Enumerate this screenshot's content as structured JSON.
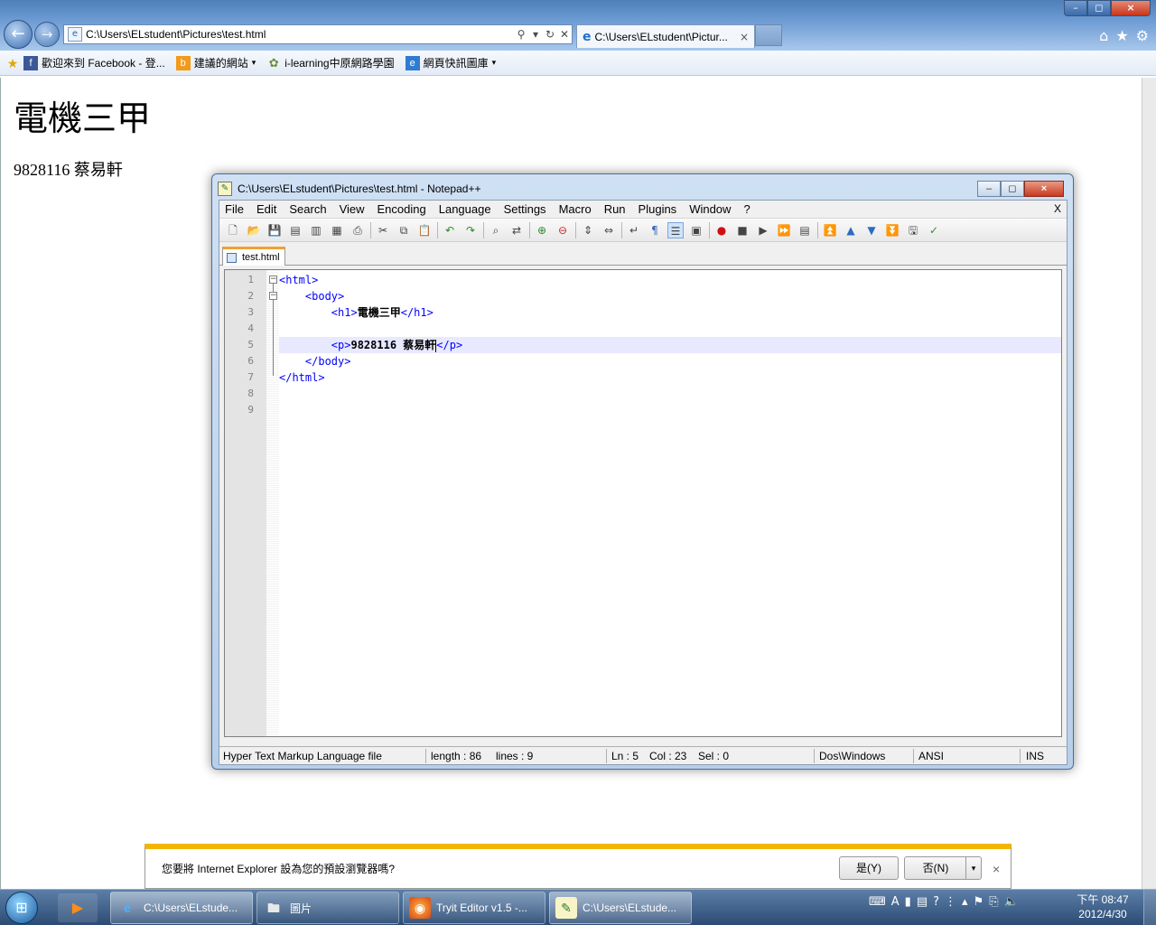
{
  "ie": {
    "address": "C:\\Users\\ELstudent\\Pictures\\test.html",
    "tab_title": "C:\\Users\\ELstudent\\Pictur...",
    "tab_close": "×",
    "win_min": "–",
    "win_max": "◻",
    "win_close": "×",
    "right_icons": {
      "home": "⌂",
      "favorites": "★",
      "tools": "⚙"
    },
    "nav": {
      "back": "←",
      "forward": "→"
    },
    "addr_tools": {
      "search": "⚲",
      "dropdown": "▾",
      "refresh": "↻",
      "stop": "✕"
    }
  },
  "favorites": {
    "items": [
      {
        "label": "歡迎來到 Facebook - 登...",
        "icon": "facebook-icon",
        "color": "#3b5998",
        "glyph": "f",
        "arrow": ""
      },
      {
        "label": "建議的網站",
        "icon": "suggested-sites-icon",
        "color": "#f29a1a",
        "glyph": "b",
        "arrow": "▾"
      },
      {
        "label": "i-learning中原網路學園",
        "icon": "ilearning-icon",
        "color": "#6a8f3c",
        "glyph": "✿",
        "arrow": ""
      },
      {
        "label": "網頁快訊圖庫",
        "icon": "web-slice-icon",
        "color": "#2f7bd1",
        "glyph": "e",
        "arrow": "▾"
      }
    ]
  },
  "page": {
    "h1": "電機三甲",
    "p": "9828116 蔡易軒"
  },
  "notification": {
    "text": "您要將 Internet Explorer 設為您的預設瀏覽器嗎?",
    "yes": "是(Y)",
    "no": "否(N)",
    "dropdown": "▾",
    "close": "×"
  },
  "npp": {
    "title": "C:\\Users\\ELstudent\\Pictures\\test.html - Notepad++",
    "menu": [
      "File",
      "Edit",
      "Search",
      "View",
      "Encoding",
      "Language",
      "Settings",
      "Macro",
      "Run",
      "Plugins",
      "Window",
      "?"
    ],
    "menu_close": "X",
    "tab": "test.html",
    "line_numbers": [
      "1",
      "2",
      "3",
      "4",
      "5",
      "6",
      "7",
      "8",
      "9"
    ],
    "code": {
      "l1": "<html>",
      "l2": "<body>",
      "l3_open": "<h1>",
      "l3_text": "電機三甲",
      "l3_close": "</h1>",
      "l5_open": "<p>",
      "l5_text": "9828116 蔡易軒",
      "l5_close": "</p>",
      "l6": "</body>",
      "l7": "</html>"
    },
    "status": {
      "filetype": "Hyper Text Markup Language file",
      "length": "length : 86",
      "lines": "lines : 9",
      "ln": "Ln : 5",
      "col": "Col : 23",
      "sel": "Sel : 0",
      "eol": "Dos\\Windows",
      "encoding": "ANSI",
      "mode": "INS"
    }
  },
  "taskbar": {
    "tasks": [
      {
        "label": "C:\\Users\\ELstude...",
        "icon": "internet-explorer-icon"
      },
      {
        "label": "圖片",
        "icon": "explorer-folder-icon"
      },
      {
        "label": "Tryit Editor v1.5 -...",
        "icon": "firefox-icon"
      },
      {
        "label": "C:\\Users\\ELstude...",
        "icon": "notepadpp-icon"
      }
    ],
    "clock_time": "下午 08:47",
    "clock_date": "2012/4/30"
  }
}
